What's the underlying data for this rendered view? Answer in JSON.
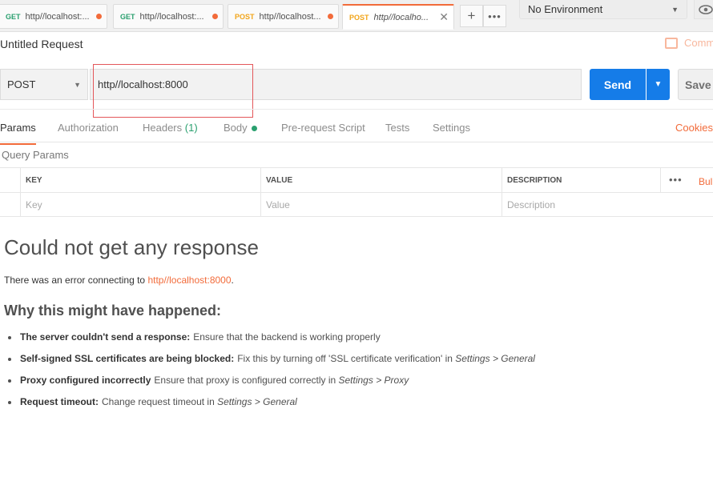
{
  "tabs": [
    {
      "method": "GET",
      "url": "http//localhost:...",
      "unsaved": true
    },
    {
      "method": "GET",
      "url": "http//localhost:...",
      "unsaved": true
    },
    {
      "method": "POST",
      "url": "http//localhost...",
      "unsaved": true
    },
    {
      "method": "POST",
      "url": "http//localho...",
      "active": true
    }
  ],
  "environment": {
    "selected": "No Environment"
  },
  "request": {
    "title": "Untitled Request",
    "comments_label": "Comm",
    "method": "POST",
    "url": "http//localhost:8000",
    "send_label": "Send",
    "save_label": "Save"
  },
  "request_tabs": {
    "params": "Params",
    "authorization": "Authorization",
    "headers": "Headers",
    "headers_count": "(1)",
    "body": "Body",
    "pre_request": "Pre-request Script",
    "tests": "Tests",
    "settings": "Settings",
    "cookies": "Cookies"
  },
  "query_params": {
    "title": "Query Params",
    "columns": {
      "key": "KEY",
      "value": "VALUE",
      "description": "DESCRIPTION"
    },
    "bulk_edit": "Bul",
    "placeholders": {
      "key": "Key",
      "value": "Value",
      "description": "Description"
    }
  },
  "response": {
    "title": "Could not get any response",
    "error_prefix": "There was an error connecting to ",
    "error_url": "http//localhost:8000",
    "error_suffix": ".",
    "why_title": "Why this might have happened:",
    "reasons": [
      {
        "label": "The server couldn't send a response:",
        "text": "Ensure that the backend is working properly",
        "em": ""
      },
      {
        "label": "Self-signed SSL certificates are being blocked:",
        "text": "Fix this by turning off 'SSL certificate verification' in ",
        "em": "Settings > General"
      },
      {
        "label": "Proxy configured incorrectly",
        "text": "Ensure that proxy is configured correctly in ",
        "em": "Settings > Proxy"
      },
      {
        "label": "Request timeout:",
        "text": "Change request timeout in ",
        "em": "Settings > General"
      }
    ]
  },
  "colors": {
    "accent": "#f26b3a",
    "send": "#157ce8",
    "get": "#2aa06f",
    "post": "#f2a51a"
  }
}
